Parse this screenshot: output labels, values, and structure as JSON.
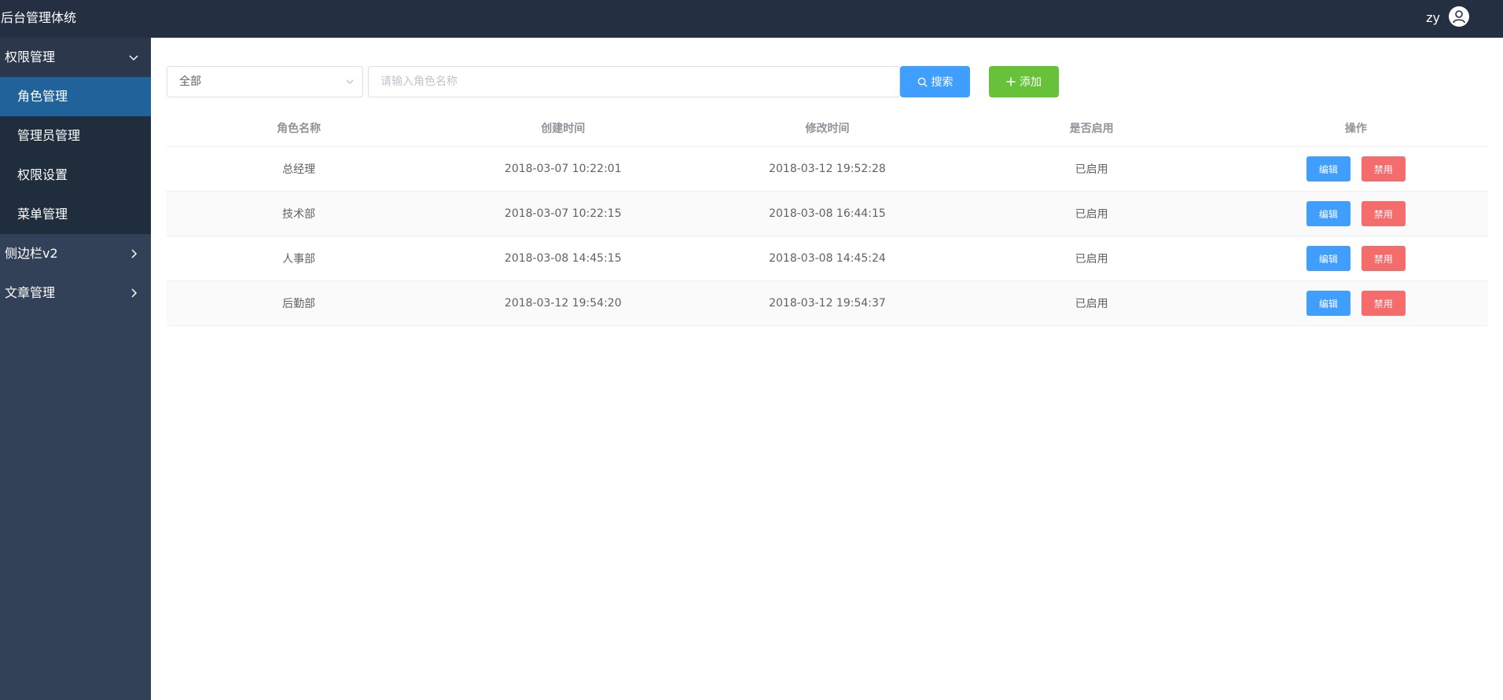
{
  "header": {
    "app_title": "后台管理体统",
    "user_name": "zy"
  },
  "sidebar": {
    "groups": [
      {
        "label": "权限管理",
        "expanded": true,
        "items": [
          {
            "label": "角色管理",
            "active": true
          },
          {
            "label": "管理员管理"
          },
          {
            "label": "权限设置"
          },
          {
            "label": "菜单管理"
          }
        ]
      },
      {
        "label": "侧边栏v2",
        "expanded": false
      },
      {
        "label": "文章管理",
        "expanded": false
      }
    ]
  },
  "toolbar": {
    "filter_value": "全部",
    "search_placeholder": "请输入角色名称",
    "search_label": "搜索",
    "add_label": "添加"
  },
  "table": {
    "headers": [
      "角色名称",
      "创建时间",
      "修改时间",
      "是否启用",
      "操作"
    ],
    "rows": [
      {
        "name": "总经理",
        "created": "2018-03-07 10:22:01",
        "modified": "2018-03-12 19:52:28",
        "status": "已启用",
        "edit": "编辑",
        "disable": "禁用"
      },
      {
        "name": "技术部",
        "created": "2018-03-07 10:22:15",
        "modified": "2018-03-08 16:44:15",
        "status": "已启用",
        "edit": "编辑",
        "disable": "禁用"
      },
      {
        "name": "人事部",
        "created": "2018-03-08 14:45:15",
        "modified": "2018-03-08 14:45:24",
        "status": "已启用",
        "edit": "编辑",
        "disable": "禁用"
      },
      {
        "name": "后勤部",
        "created": "2018-03-12 19:54:20",
        "modified": "2018-03-12 19:54:37",
        "status": "已启用",
        "edit": "编辑",
        "disable": "禁用"
      }
    ]
  },
  "colors": {
    "header_bg": "#242f42",
    "sidebar_bg": "#324157",
    "submenu_bg": "#1f2d3d",
    "active_item_bg": "#20639b",
    "primary": "#409eff",
    "success": "#67c23a",
    "danger": "#f56c6c"
  }
}
